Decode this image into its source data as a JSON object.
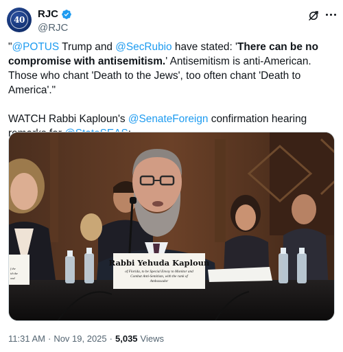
{
  "author": {
    "display_name": "RJC",
    "handle": "@RJC",
    "avatar_text": "40"
  },
  "tweet": {
    "p1": [
      {
        "text": "\"",
        "type": "text"
      },
      {
        "text": "@POTUS",
        "type": "mention"
      },
      {
        "text": " Trump and ",
        "type": "text"
      },
      {
        "text": "@SecRubio",
        "type": "mention"
      },
      {
        "text": " have stated: '",
        "type": "text"
      },
      {
        "text": "There can be no compromise with antisemitism.",
        "type": "bold"
      },
      {
        "text": "' Antisemitism is anti-American. Those who chant 'Death to the Jews', too often chant 'Death to America'.\"",
        "type": "text"
      }
    ],
    "p2": [
      {
        "text": "WATCH Rabbi Kaploun's ",
        "type": "text"
      },
      {
        "text": "@SenateForeign",
        "type": "mention"
      },
      {
        "text": " confirmation hearing remarks for ",
        "type": "text"
      },
      {
        "text": "@StateSEAS",
        "type": "mention"
      },
      {
        "text": ":",
        "type": "text"
      }
    ]
  },
  "media": {
    "placard_name": "Rabbi Yehuda Kaploun",
    "placard_line1": "of Florida, to be Special Envoy to Monitor and",
    "placard_line2": "Combat Anti-Semitism, with the rank of",
    "placard_line3": "Ambassador",
    "side_placard_line1": "f the",
    "side_placard_line2": "ith the",
    "side_placard_line3": "ond"
  },
  "meta": {
    "time": "11:31 AM",
    "sep1": "·",
    "date": "Nov 19, 2025",
    "sep2": "·",
    "views_count": "5,035",
    "views_label": "Views"
  },
  "colors": {
    "link": "#1d9bf0",
    "text": "#0f1419",
    "secondary": "#536471"
  }
}
